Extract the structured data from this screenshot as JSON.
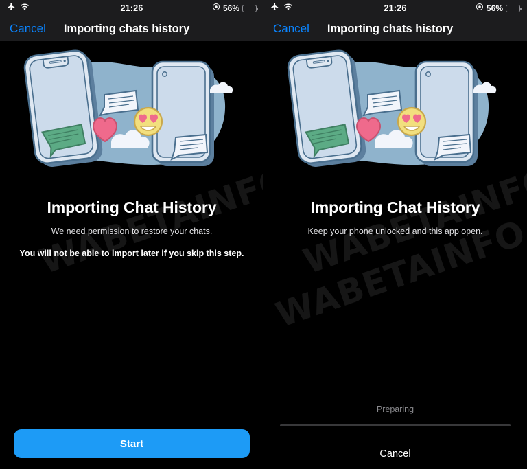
{
  "status_bar": {
    "airplane_icon": "airplane-icon",
    "wifi_icon": "wifi-icon",
    "time": "21:26",
    "alarm_icon": "alarm-icon",
    "battery_percent": "56%",
    "battery_level": 56
  },
  "nav": {
    "cancel_label": "Cancel",
    "title": "Importing chats history"
  },
  "watermark": {
    "text": "WABETAINFO"
  },
  "illustration": {
    "name": "chat-history-transfer-illustration",
    "colors": {
      "blob": "#8fb3cc",
      "phone_body": "#dfe8f2",
      "phone_screen": "#ccdbeb",
      "outline": "#4a6f8e",
      "shadow": "#5c7f9e",
      "heart": "#ef6a8c",
      "emoji": "#f2df7e",
      "emoji_outline": "#c9a84c",
      "green_bubble": "#5cab85",
      "green_bubble_outline": "#3f7f62",
      "cloud": "#f2f5fb",
      "white_bubble": "#f2f5fb"
    }
  },
  "panels": [
    {
      "id": "permission-panel",
      "headline": "Importing Chat History",
      "subline": "We need permission to restore your chats.",
      "warning": "You will not be able to import later if you skip this step.",
      "cta_label": "Start",
      "cta_color": "#1d9bf6"
    },
    {
      "id": "progress-panel",
      "headline": "Importing Chat History",
      "subline": "Keep your phone unlocked and this app open.",
      "progress_label": "Preparing",
      "progress_percent": 0,
      "cancel_label": "Cancel"
    }
  ]
}
